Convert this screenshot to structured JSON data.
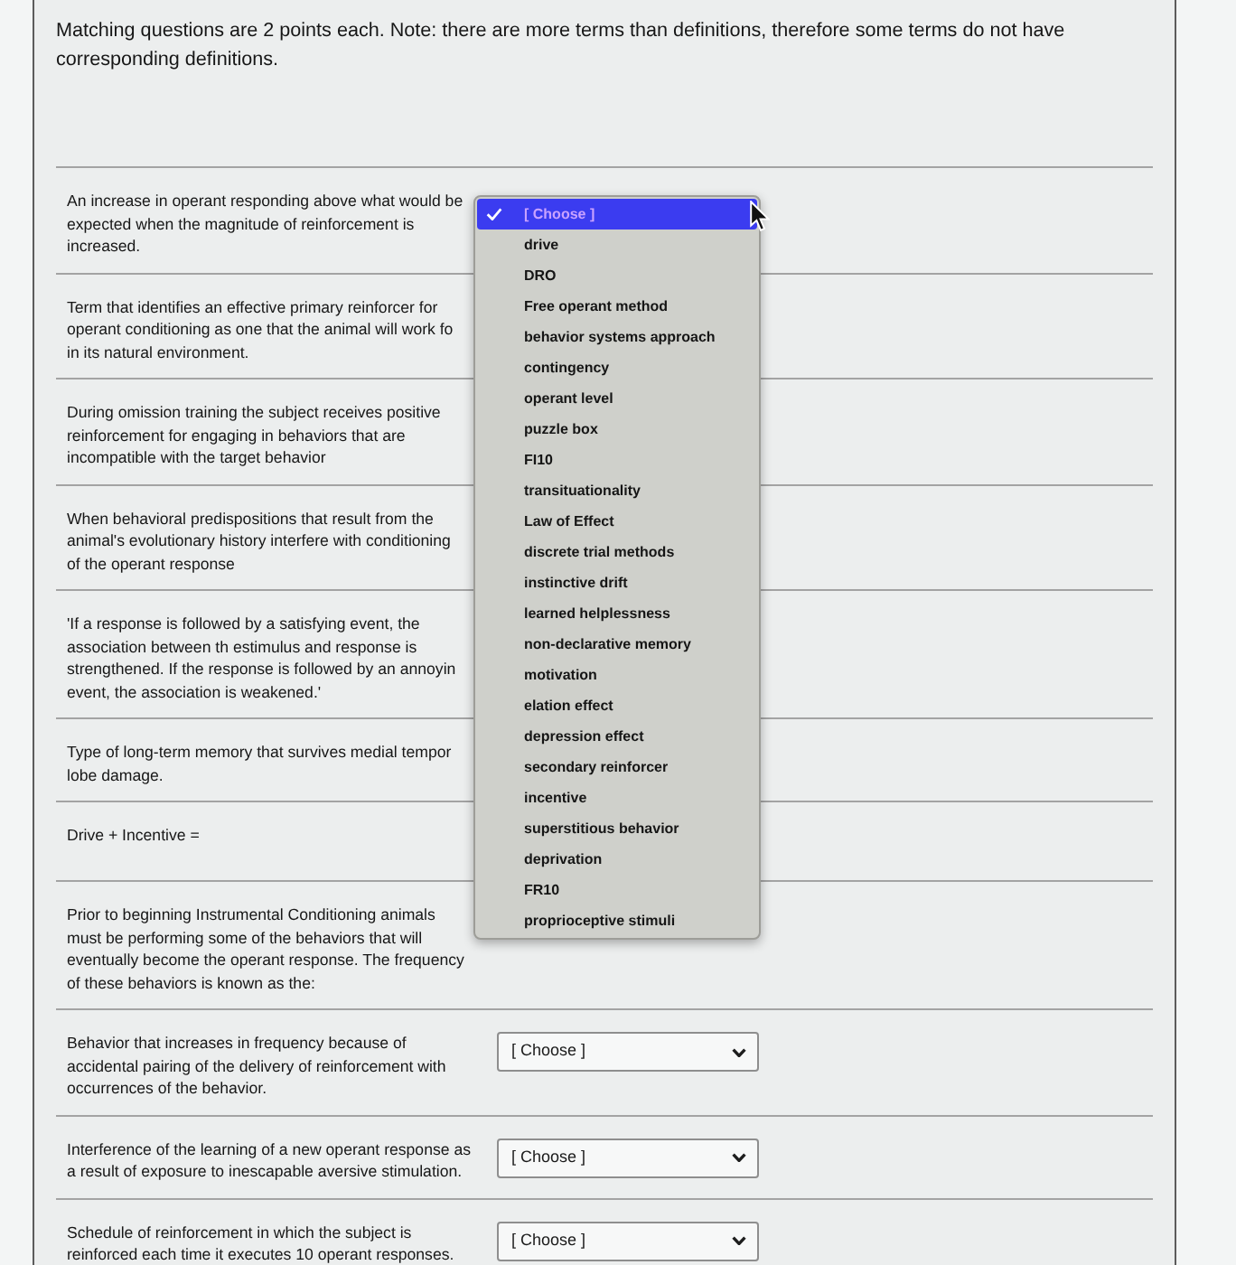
{
  "instructions": "Matching questions are 2 points each. Note: there are more terms than definitions, therefore some terms do not have corresponding definitions.",
  "questions": [
    {
      "lines": [
        "An increase in operant responding above what would be",
        "expected when the magnitude of reinforcement is",
        "increased."
      ],
      "select": {
        "open": true,
        "options": [
          {
            "label": "[ Choose ]",
            "selected": true
          },
          {
            "label": "drive",
            "selected": false
          },
          {
            "label": "DRO",
            "selected": false
          },
          {
            "label": "Free operant method",
            "selected": false
          },
          {
            "label": "behavior systems approach",
            "selected": false
          },
          {
            "label": "contingency",
            "selected": false
          },
          {
            "label": "operant level",
            "selected": false
          },
          {
            "label": "puzzle box",
            "selected": false
          },
          {
            "label": "FI10",
            "selected": false
          },
          {
            "label": "transituationality",
            "selected": false
          },
          {
            "label": "Law of Effect",
            "selected": false
          },
          {
            "label": "discrete trial methods",
            "selected": false
          },
          {
            "label": "instinctive drift",
            "selected": false
          },
          {
            "label": "learned helplessness",
            "selected": false
          },
          {
            "label": "non-declarative memory",
            "selected": false
          },
          {
            "label": "motivation",
            "selected": false
          },
          {
            "label": "elation effect",
            "selected": false
          },
          {
            "label": "depression effect",
            "selected": false
          },
          {
            "label": "secondary reinforcer",
            "selected": false
          },
          {
            "label": "incentive",
            "selected": false
          },
          {
            "label": "superstitious behavior",
            "selected": false
          },
          {
            "label": "deprivation",
            "selected": false
          },
          {
            "label": "FR10",
            "selected": false
          },
          {
            "label": "proprioceptive stimuli",
            "selected": false
          }
        ]
      }
    },
    {
      "lines": [
        "Term that identifies an effective primary reinforcer for",
        "operant conditioning as one that the animal will work fo",
        "in its natural environment."
      ]
    },
    {
      "lines": [
        "During omission training the subject receives positive",
        "reinforcement for engaging in behaviors that are",
        "incompatible with the target behavior"
      ]
    },
    {
      "lines": [
        "When behavioral predispositions that result from the",
        "animal's evolutionary history interfere with conditioning",
        "of the operant response"
      ]
    },
    {
      "lines": [
        "'If a response is followed by a satisfying event, the",
        "association between th estimulus and response is",
        "strengthened. If the response is followed by an annoyin",
        "event, the association is weakened.'"
      ]
    },
    {
      "lines": [
        "Type of long-term memory that survives medial tempor",
        "lobe damage."
      ]
    },
    {
      "lines": [
        "Drive + Incentive ="
      ]
    },
    {
      "lines": [
        "Prior to beginning Instrumental Conditioning animals",
        "must be performing some of the behaviors that will",
        "eventually become the operant response. The frequency",
        "of these behaviors is known as the:"
      ]
    },
    {
      "lines": [
        "Behavior that increases in frequency because of",
        "accidental pairing of the delivery of reinforcement with",
        "occurrences of the behavior."
      ],
      "select": {
        "open": false,
        "value": "[ Choose ]"
      }
    },
    {
      "lines": [
        "Interference of the learning of a new operant response as",
        "a result of exposure to inescapable aversive stimulation."
      ],
      "select": {
        "open": false,
        "value": "[ Choose ]"
      }
    },
    {
      "lines": [
        "Schedule of reinforcement in which the subject is",
        "reinforced each time it executes 10 operant responses."
      ],
      "select": {
        "open": false,
        "value": "[ Choose ]"
      }
    }
  ]
}
